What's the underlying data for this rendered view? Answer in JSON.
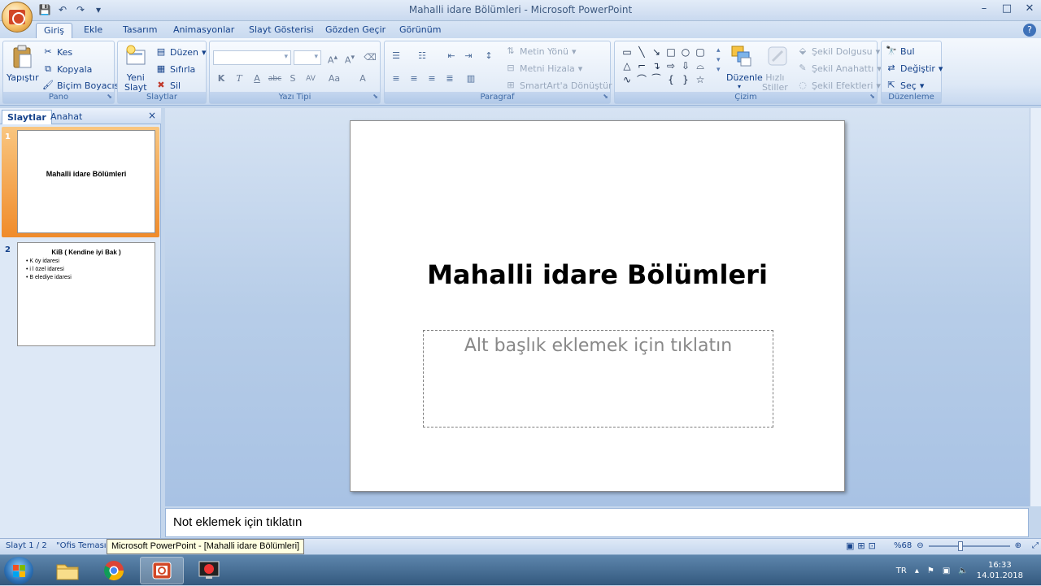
{
  "window": {
    "title": "Mahalli idare Bölümleri - Microsoft PowerPoint"
  },
  "tabs": [
    "Giriş",
    "Ekle",
    "Tasarım",
    "Animasyonlar",
    "Slayt Gösterisi",
    "Gözden Geçir",
    "Görünüm"
  ],
  "ribbon": {
    "pano": {
      "label": "Pano",
      "paste": "Yapıştır",
      "cut": "Kes",
      "copy": "Kopyala",
      "format_painter": "Biçim Boyacısı"
    },
    "slaytlar": {
      "label": "Slaytlar",
      "new_slide_1": "Yeni",
      "new_slide_2": "Slayt",
      "layout": "Düzen",
      "reset": "Sıfırla",
      "delete": "Sil"
    },
    "yazi_tipi": {
      "label": "Yazı Tipi"
    },
    "paragraf": {
      "label": "Paragraf",
      "text_direction": "Metin Yönü",
      "align_text": "Metni Hizala",
      "smartart": "SmartArt'a Dönüştür"
    },
    "cizim": {
      "label": "Çizim",
      "arrange": "Düzenle",
      "quick_styles_1": "Hızlı",
      "quick_styles_2": "Stiller",
      "shape_fill": "Şekil Dolgusu",
      "shape_outline": "Şekil Anahattı",
      "shape_effects": "Şekil Efektleri"
    },
    "duzenleme": {
      "label": "Düzenleme",
      "find": "Bul",
      "replace": "Değiştir",
      "select": "Seç"
    }
  },
  "side_panel": {
    "tabs": [
      "Slaytlar",
      "Anahat"
    ],
    "slides": [
      {
        "number": "1",
        "title": "Mahalli idare Bölümleri",
        "bullets": []
      },
      {
        "number": "2",
        "title": "KiB ( Kendine iyi Bak )",
        "bullets": [
          "K öy idaresi",
          "i l özel idaresi",
          "B elediye idaresi"
        ]
      }
    ]
  },
  "slide": {
    "title": "Mahalli idare Bölümleri",
    "subtitle_placeholder": "Alt başlık eklemek için tıklatın"
  },
  "notes": {
    "placeholder": "Not eklemek için tıklatın"
  },
  "status": {
    "slide_counter": "Slayt 1 / 2",
    "theme": "\"Ofis Teması\"",
    "zoom": "%68",
    "tooltip": "Microsoft PowerPoint - [Mahalli idare Bölümleri]"
  },
  "taskbar": {
    "language": "TR",
    "time": "16:33",
    "date": "14.01.2018"
  },
  "colors": {
    "selected_thumb": "#f4a04a",
    "ribbon_text": "#15428b",
    "editor_bg": "#b7cde8"
  }
}
